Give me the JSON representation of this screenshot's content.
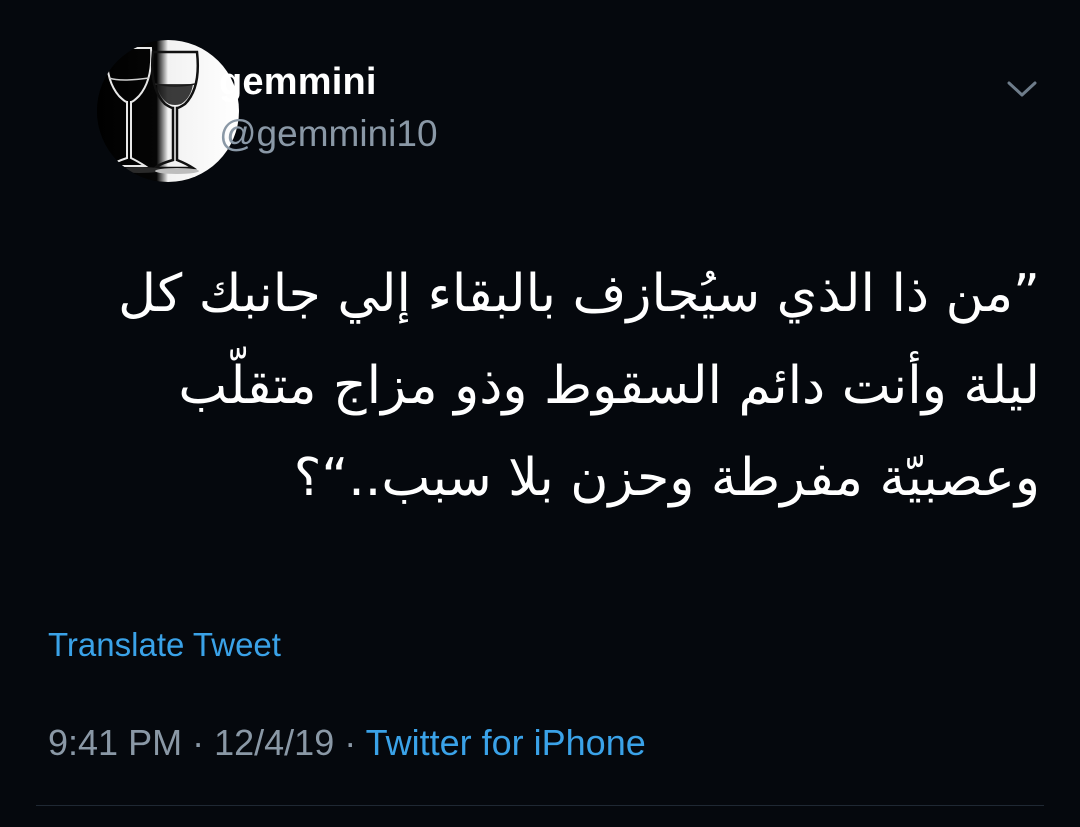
{
  "tweet": {
    "display_name": "gemmini",
    "handle": "@gemmini10",
    "text": "”من ذا الذي سيُجازف بالبقاء إلي جانبك كل\nليلة وأنت دائم السقوط وذو مزاج متقلّب\nوعصبيّة مفرطة وحزن بلا سبب..“؟",
    "translate_label": "Translate Tweet",
    "time": "9:41 PM",
    "separator": "·",
    "date": "12/4/19",
    "source": "Twitter for iPhone"
  },
  "icons": {
    "menu": "chevron-down-icon",
    "avatar": "wine-glasses-avatar"
  },
  "colors": {
    "background": "#05080d",
    "primary_text": "#ffffff",
    "secondary_text": "#8a98a6",
    "link": "#3aa2e8"
  }
}
